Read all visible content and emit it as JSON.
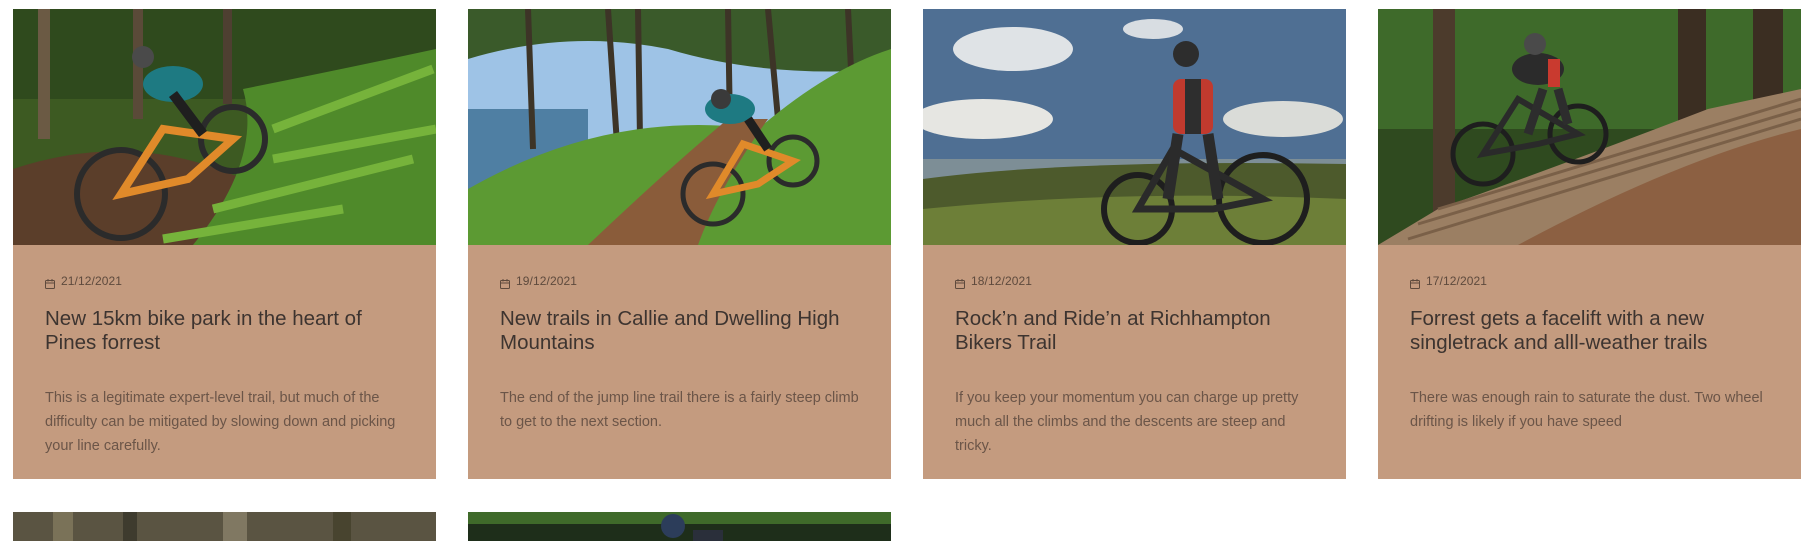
{
  "posts": [
    {
      "image_alt": "Rider on orange e-bike descending fern trail",
      "date": "21/12/2021",
      "title": "New 15km bike park in the heart of Pines forrest",
      "excerpt": "This is a legitimate expert-level trail, but much of the difficulty can be mitigated by slowing down and picking your line carefully."
    },
    {
      "image_alt": "Rider on coastal trail among pines",
      "date": "19/12/2021",
      "title": "New trails in Callie and Dwelling High Mountains",
      "excerpt": "The end of the jump line trail there is a fairly steep climb to get to the next section."
    },
    {
      "image_alt": "Rider standing with bike on a hilltop",
      "date": "18/12/2021",
      "title": "Rock’n and Ride’n at Richhampton Bikers Trail",
      "excerpt": "If you keep your momentum you can charge up pretty much all the climbs and the descents are steep and tricky."
    },
    {
      "image_alt": "Rider on wooden boardwalk in forest",
      "date": "17/12/2021",
      "title": "Forrest gets a facelift with a new singletrack and alll-weather trails",
      "excerpt": "There was enough rain to saturate the dust. Two wheel drifting is likely if you have speed"
    }
  ],
  "colors": {
    "card_background": "#c49b7f",
    "title": "#3d3430",
    "excerpt": "#6b5548",
    "date": "#5e4a3d"
  },
  "icons": {
    "date": "calendar-icon"
  }
}
